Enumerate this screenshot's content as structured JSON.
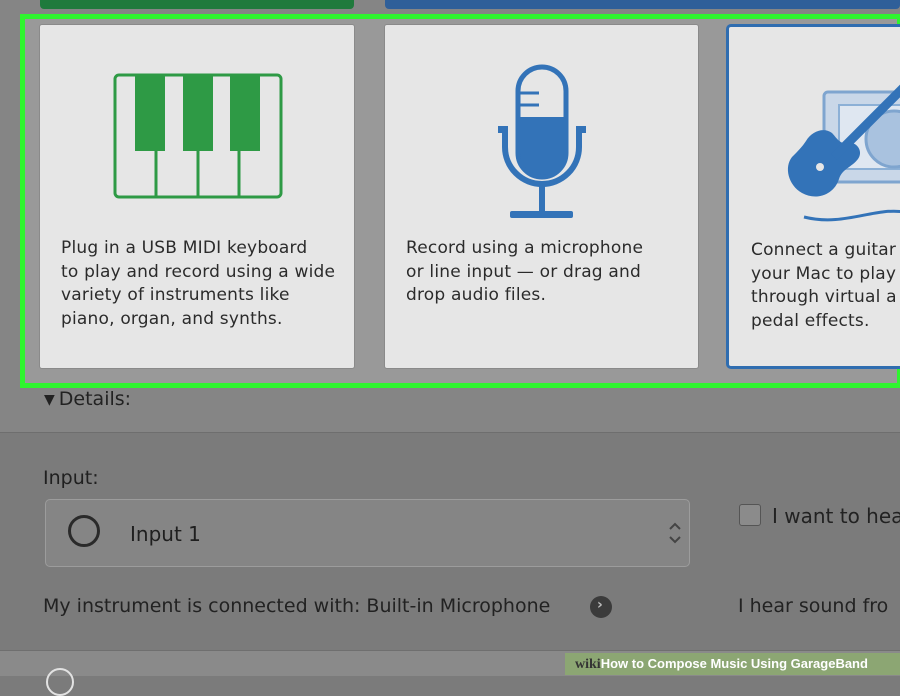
{
  "cards": [
    {
      "id": "keyboard",
      "text": "Plug in a USB MIDI keyboard\nto play and record using a wide\nvariety of instruments like\npiano, organ, and synths.",
      "icon": "piano-keyboard-icon"
    },
    {
      "id": "microphone",
      "text": "Record using a microphone\nor line input — or drag and\ndrop audio files.",
      "icon": "microphone-icon"
    },
    {
      "id": "guitar",
      "text": "Connect a guitar\nyour Mac to play\nthrough virtual a\npedal effects.",
      "icon": "guitar-icon"
    }
  ],
  "details": {
    "label": "Details:"
  },
  "input": {
    "label": "Input:",
    "value": "Input 1"
  },
  "hear_checkbox": {
    "label": "I want to hea"
  },
  "connected": {
    "text": "My instrument is connected with: Built-in Microphone"
  },
  "hear_sound": {
    "text": "I hear sound fro"
  },
  "watermark": {
    "prefix": "wiki",
    "text": "How to Compose Music Using GarageBand"
  },
  "colors": {
    "highlight": "#2ff52f",
    "keyboard_green": "#2e9a45",
    "mic_blue": "#3373b8",
    "selected_border": "#2f6db0"
  }
}
